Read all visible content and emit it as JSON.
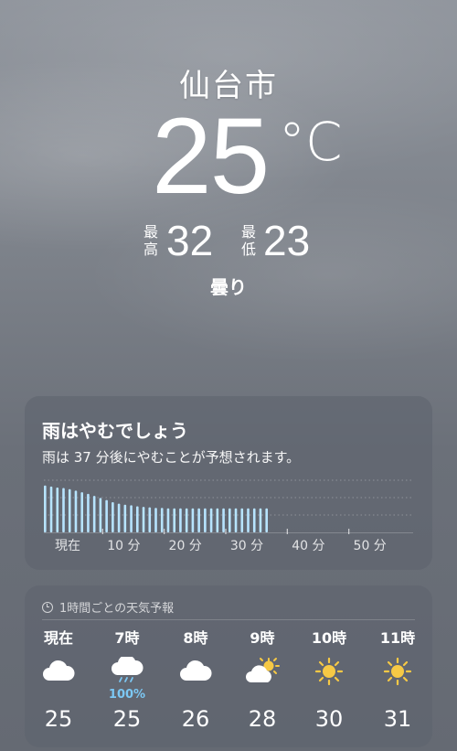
{
  "location": {
    "city": "仙台市"
  },
  "current": {
    "temperature": "25",
    "unit": "°C",
    "high_label": "最\n高",
    "high": "32",
    "low_label": "最\n低",
    "low": "23",
    "condition": "曇り"
  },
  "rain": {
    "title": "雨はやむでしょう",
    "subtitle": "雨は 37 分後にやむことが予想されます。",
    "axis_labels": [
      "現在",
      "10 分",
      "20 分",
      "30 分",
      "40 分",
      "50 分"
    ],
    "colors": {
      "bar": "#b7e4ff",
      "grid": "rgba(255,255,255,0.28)"
    }
  },
  "chart_data": {
    "type": "bar",
    "title": "雨はやむでしょう",
    "x_unit": "分",
    "x": [
      0,
      1,
      2,
      3,
      4,
      5,
      6,
      7,
      8,
      9,
      10,
      11,
      12,
      13,
      14,
      15,
      16,
      17,
      18,
      19,
      20,
      21,
      22,
      23,
      24,
      25,
      26,
      27,
      28,
      29,
      30,
      31,
      32,
      33,
      34,
      35,
      36
    ],
    "values": [
      0.9,
      0.88,
      0.86,
      0.85,
      0.83,
      0.8,
      0.77,
      0.74,
      0.7,
      0.66,
      0.62,
      0.58,
      0.55,
      0.53,
      0.52,
      0.5,
      0.49,
      0.48,
      0.47,
      0.47,
      0.46,
      0.46,
      0.46,
      0.46,
      0.46,
      0.46,
      0.46,
      0.46,
      0.46,
      0.46,
      0.46,
      0.46,
      0.46,
      0.46,
      0.46,
      0.46,
      0.46
    ],
    "ylim": [
      0,
      1
    ],
    "tick_labels": [
      "現在",
      "10 分",
      "20 分",
      "30 分",
      "40 分",
      "50 分"
    ],
    "grid": true
  },
  "hourly": {
    "header": "1時間ごとの天気予報",
    "items": [
      {
        "time": "現在",
        "icon": "cloud-icon",
        "precip": "",
        "temp": "25"
      },
      {
        "time": "7時",
        "icon": "cloud-rain-icon",
        "precip": "100%",
        "temp": "25"
      },
      {
        "time": "8時",
        "icon": "cloud-icon",
        "precip": "",
        "temp": "26"
      },
      {
        "time": "9時",
        "icon": "partly-sunny-icon",
        "precip": "",
        "temp": "28"
      },
      {
        "time": "10時",
        "icon": "sun-icon",
        "precip": "",
        "temp": "30"
      },
      {
        "time": "11時",
        "icon": "sun-icon",
        "precip": "",
        "temp": "31"
      }
    ]
  }
}
